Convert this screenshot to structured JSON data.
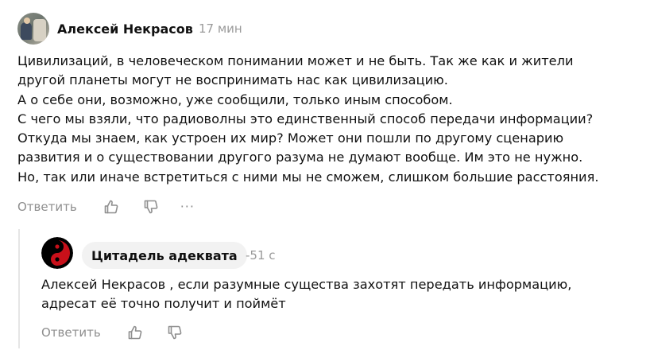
{
  "comment": {
    "author": "Алексей Некрасов",
    "time": "17 мин",
    "lines": [
      "Цивилизаций, в человеческом понимании может и не быть. Так же как и жители",
      "другой планеты могут не воспринимать нас как цивилизацию.",
      "А о себе они, возможно, уже сообщили, только иным способом.",
      "С чего мы взяли, что радиоволны это единственный способ передачи информации?",
      "Откуда мы знаем, как устроен их мир? Может они пошли по другому сценарию",
      "развития и о существовании другого разума не думают вообще. Им это не нужно.",
      "Но, так или иначе встретиться с ними мы не сможем, слишком большие расстояния."
    ],
    "actions": {
      "reply_label": "Ответить",
      "like_icon": "thumbs-up-icon",
      "dislike_icon": "thumbs-down-icon",
      "more_label": "···"
    }
  },
  "reply": {
    "author": "Цитадель адеквата",
    "time": "-51 с",
    "avatar_icon": "yin-yang-icon",
    "lines": [
      "Алексей Некрасов , если разумные существа захотят передать информацию,",
      "адресат её точно получит и поймёт"
    ],
    "actions": {
      "reply_label": "Ответить",
      "like_icon": "thumbs-up-icon",
      "dislike_icon": "thumbs-down-icon"
    }
  },
  "colors": {
    "text": "#111111",
    "muted": "#8e8e8e",
    "pill_bg": "#f2f2f2",
    "thread_line": "#e6e6e6",
    "avatar_red": "#c8101a"
  }
}
